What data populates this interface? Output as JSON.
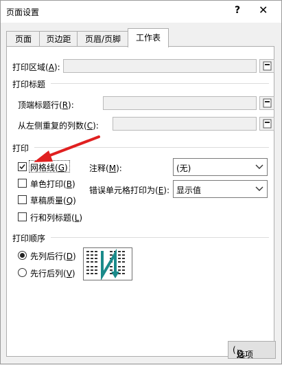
{
  "dialog": {
    "title": "页面设置",
    "help_glyph": "?",
    "close_glyph": "✕"
  },
  "tabs": [
    {
      "label": "页面",
      "active": false
    },
    {
      "label": "页边距",
      "active": false
    },
    {
      "label": "页眉/页脚",
      "active": false
    },
    {
      "label": "工作表",
      "active": true
    }
  ],
  "print_area": {
    "label": "打印区域",
    "key": "A",
    "value": ""
  },
  "print_titles": {
    "group_label": "打印标题",
    "rows_label": "顶端标题行",
    "rows_key": "R",
    "rows_value": "",
    "cols_label": "从左侧重复的列数",
    "cols_key": "C",
    "cols_value": ""
  },
  "print": {
    "group_label": "打印",
    "options": [
      {
        "label": "网格线",
        "key": "G",
        "checked": true
      },
      {
        "label": "单色打印",
        "key": "B",
        "checked": false
      },
      {
        "label": "草稿质量",
        "key": "Q",
        "checked": false
      },
      {
        "label": "行和列标题",
        "key": "L",
        "checked": false
      }
    ],
    "comments_label": "注释",
    "comments_key": "M",
    "comments_value": "(无)",
    "errors_label": "错误单元格打印为",
    "errors_key": "E",
    "errors_value": "显示值"
  },
  "page_order": {
    "group_label": "打印顺序",
    "options": [
      {
        "label": "先列后行",
        "key": "D",
        "selected": true
      },
      {
        "label": "先行后列",
        "key": "V",
        "selected": false
      }
    ]
  },
  "footer": {
    "options_label": "选项",
    "options_key": "O",
    "options_suffix": ")..."
  },
  "colors": {
    "accent_arrow": "#e02020",
    "order_arrow": "#1a8a8a"
  }
}
